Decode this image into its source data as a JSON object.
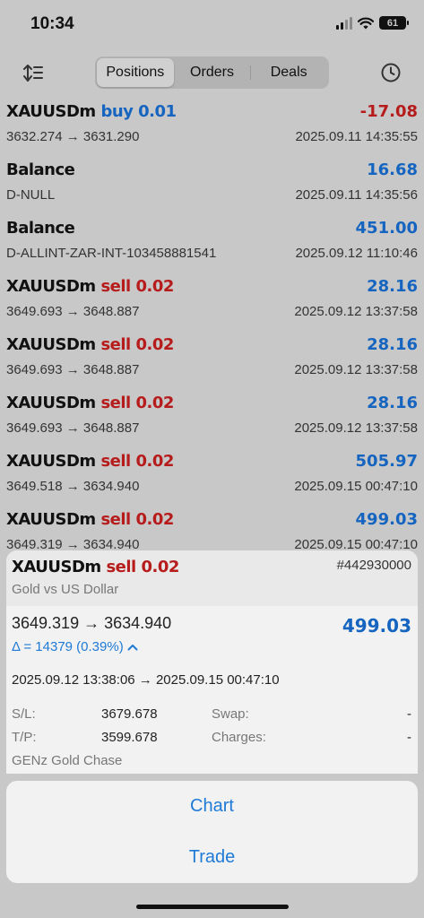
{
  "status": {
    "time": "10:34",
    "battery": "61"
  },
  "toolbar": {
    "tabs": [
      {
        "label": "Positions"
      },
      {
        "label": "Orders"
      },
      {
        "label": "Deals"
      }
    ],
    "active_tab": "Positions"
  },
  "deals": [
    {
      "symbol": "XAUUSDm",
      "side": "buy",
      "side_label": "buy 0.01",
      "amount": "-17.08",
      "amount_sign": "neg",
      "sub": "3632.274 → 3631.290",
      "time": "2025.09.11 14:35:55"
    },
    {
      "symbol": "Balance",
      "side": "",
      "side_label": "",
      "amount": "16.68",
      "amount_sign": "pos",
      "sub": "D-NULL",
      "time": "2025.09.11 14:35:56"
    },
    {
      "symbol": "Balance",
      "side": "",
      "side_label": "",
      "amount": "451.00",
      "amount_sign": "pos",
      "sub": "D-ALLINT-ZAR-INT-103458881541",
      "time": "2025.09.12 11:10:46"
    },
    {
      "symbol": "XAUUSDm",
      "side": "sell",
      "side_label": "sell 0.02",
      "amount": "28.16",
      "amount_sign": "pos",
      "sub": "3649.693 → 3648.887",
      "time": "2025.09.12 13:37:58"
    },
    {
      "symbol": "XAUUSDm",
      "side": "sell",
      "side_label": "sell 0.02",
      "amount": "28.16",
      "amount_sign": "pos",
      "sub": "3649.693 → 3648.887",
      "time": "2025.09.12 13:37:58"
    },
    {
      "symbol": "XAUUSDm",
      "side": "sell",
      "side_label": "sell 0.02",
      "amount": "28.16",
      "amount_sign": "pos",
      "sub": "3649.693 → 3648.887",
      "time": "2025.09.12 13:37:58"
    },
    {
      "symbol": "XAUUSDm",
      "side": "sell",
      "side_label": "sell 0.02",
      "amount": "505.97",
      "amount_sign": "pos",
      "sub": "3649.518 → 3634.940",
      "time": "2025.09.15 00:47:10"
    },
    {
      "symbol": "XAUUSDm",
      "side": "sell",
      "side_label": "sell 0.02",
      "amount": "499.03",
      "amount_sign": "pos",
      "sub": "3649.319 → 3634.940",
      "time": "2025.09.15 00:47:10"
    }
  ],
  "detail": {
    "symbol": "XAUUSDm",
    "side_label": "sell 0.02",
    "order_id": "#442930000",
    "description": "Gold vs US Dollar",
    "prices": "3649.319 → 3634.940",
    "profit": "499.03",
    "delta": "Δ = 14379 (0.39%)",
    "times": "2025.09.12 13:38:06 → 2025.09.15 00:47:10",
    "sl_label": "S/L:",
    "sl_value": "3679.678",
    "tp_label": "T/P:",
    "tp_value": "3599.678",
    "swap_label": "Swap:",
    "swap_value": "-",
    "charges_label": "Charges:",
    "charges_value": "-",
    "comment": "GENz Gold Chase"
  },
  "actions": {
    "chart": "Chart",
    "trade": "Trade"
  },
  "colors": {
    "buy": "#1565c0",
    "sell": "#b71c1c",
    "profit": "#1565c0",
    "loss": "#b71c1c",
    "link": "#1e7ad6"
  }
}
